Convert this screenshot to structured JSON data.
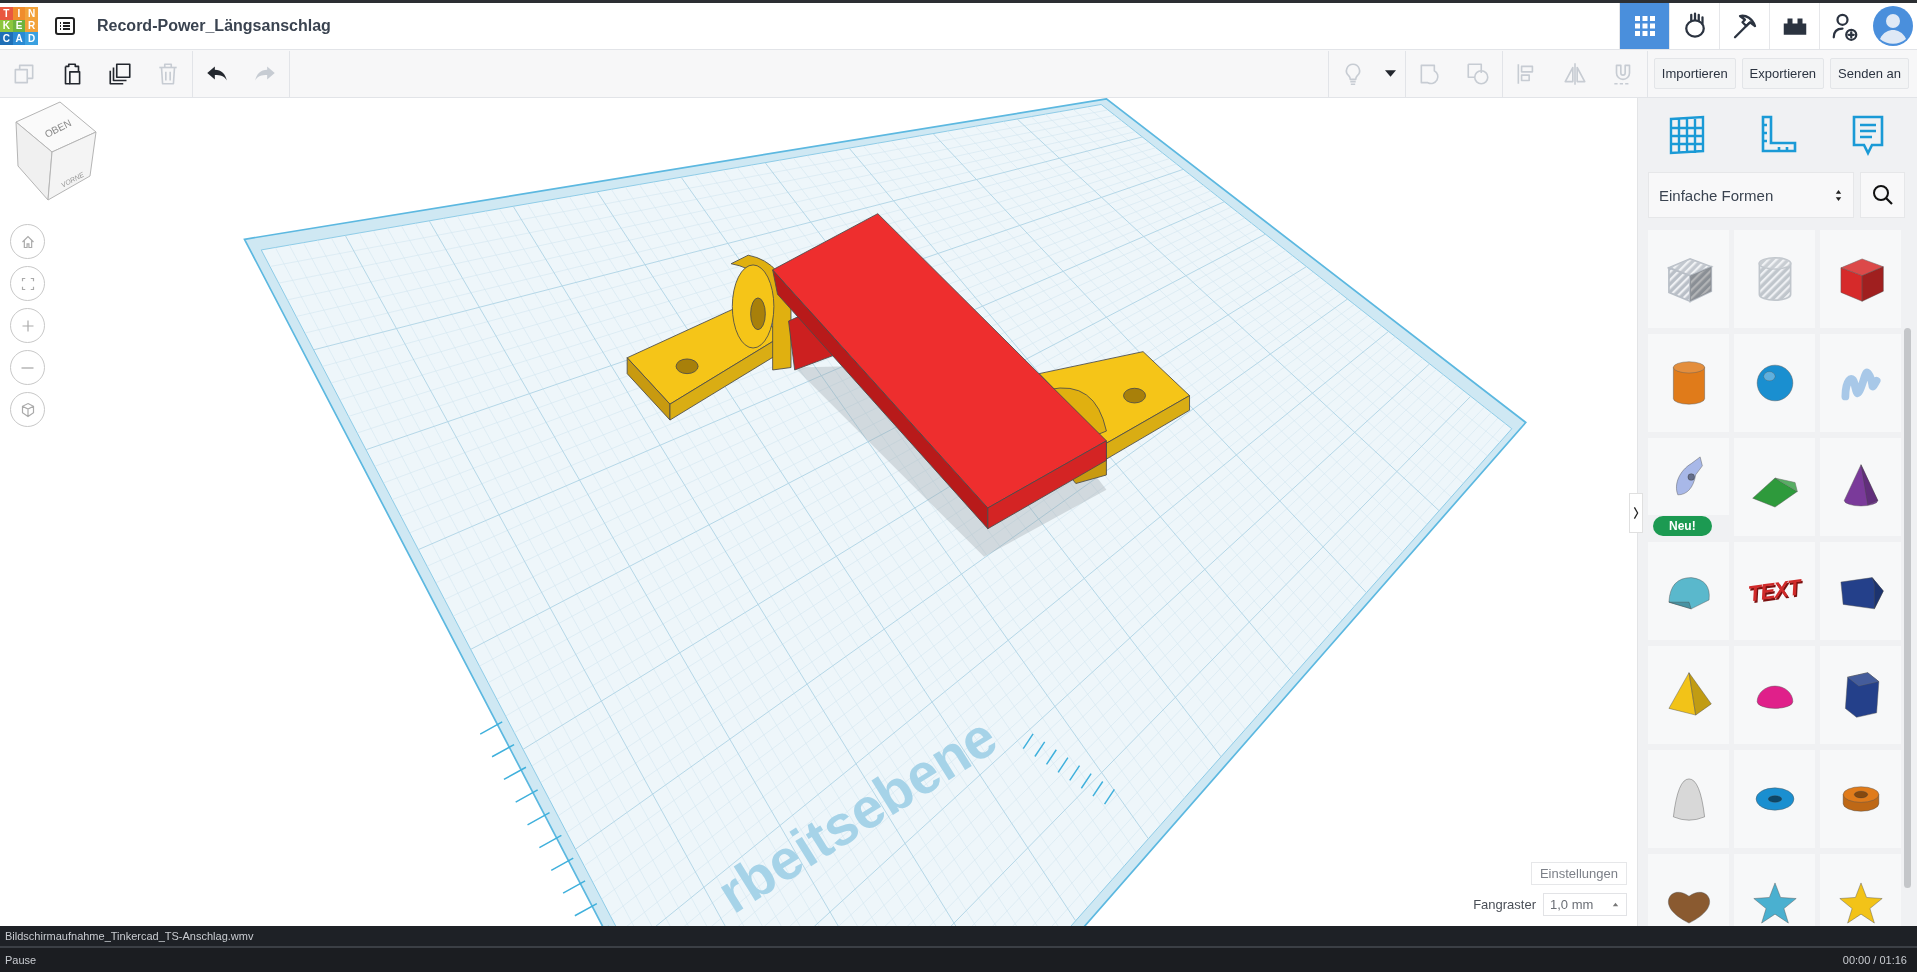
{
  "header": {
    "logo": [
      {
        "letter": "T",
        "color": "#e9573f"
      },
      {
        "letter": "I",
        "color": "#f08c2c"
      },
      {
        "letter": "N",
        "color": "#f2a23a"
      },
      {
        "letter": "K",
        "color": "#8cc63e"
      },
      {
        "letter": "E",
        "color": "#6db33f"
      },
      {
        "letter": "R",
        "color": "#f2a23a"
      },
      {
        "letter": "C",
        "color": "#1e6fb7"
      },
      {
        "letter": "A",
        "color": "#2a8ad4"
      },
      {
        "letter": "D",
        "color": "#3aa0e0"
      }
    ],
    "title": "Record-Power_Längsanschlag",
    "tools": [
      {
        "kind": "grid",
        "selected": true
      },
      {
        "kind": "hand",
        "selected": false
      },
      {
        "kind": "pickaxe",
        "selected": false
      },
      {
        "kind": "brick",
        "selected": false
      },
      {
        "kind": "add-user",
        "selected": false
      }
    ]
  },
  "toolbar": {
    "left": [
      {
        "kind": "copy",
        "disabled": true
      },
      {
        "kind": "paste",
        "disabled": false
      },
      {
        "kind": "duplicate",
        "disabled": false
      },
      {
        "kind": "delete",
        "disabled": true
      },
      {
        "kind": "undo",
        "disabled": false
      },
      {
        "kind": "redo",
        "disabled": true
      }
    ],
    "right": [
      {
        "kind": "light",
        "disabled": true
      },
      {
        "kind": "dropdown",
        "disabled": false
      },
      {
        "kind": "group",
        "disabled": true
      },
      {
        "kind": "ungroup",
        "disabled": true
      },
      {
        "kind": "align",
        "disabled": true
      },
      {
        "kind": "mirror",
        "disabled": true
      },
      {
        "kind": "magnet",
        "disabled": true
      }
    ],
    "buttons": [
      "Importieren",
      "Exportieren",
      "Senden an"
    ]
  },
  "view_cube": {
    "top": "OBEN",
    "front": "VORNE"
  },
  "workplane": {
    "label": "rbeitsebene"
  },
  "canvas_controls": {
    "settings": "Einstellungen",
    "snap_label": "Fangraster",
    "snap_value": "1,0 mm"
  },
  "sidebar": {
    "category": "Einfache Formen",
    "shapes": [
      {
        "kind": "striped-cube",
        "color": "#b9bfc7"
      },
      {
        "kind": "striped-cylinder",
        "color": "#c0c6cc"
      },
      {
        "kind": "cube",
        "color": "#d62a2a"
      },
      {
        "kind": "cylinder",
        "color": "#e07b1a"
      },
      {
        "kind": "sphere",
        "color": "#1a8fd0"
      },
      {
        "kind": "squiggle",
        "color": "#a8c8e8"
      },
      {
        "kind": "pen-tip",
        "color": "#a8b8e8",
        "badge": "Neu!"
      },
      {
        "kind": "wedge",
        "color": "#2e9a3c"
      },
      {
        "kind": "cone",
        "color": "#7a3a9a"
      },
      {
        "kind": "half-cylinder",
        "color": "#5ab8cc"
      },
      {
        "kind": "text",
        "color": "#d02a2a",
        "label": "TEXT"
      },
      {
        "kind": "pentagon-prism",
        "color": "#24408a"
      },
      {
        "kind": "pyramid",
        "color": "#f2c318"
      },
      {
        "kind": "dome",
        "color": "#e0208a"
      },
      {
        "kind": "hexagonal-prism",
        "color": "#24408a"
      },
      {
        "kind": "paraboloid",
        "color": "#d8d8d8"
      },
      {
        "kind": "ring",
        "color": "#1a8fd0"
      },
      {
        "kind": "tube",
        "color": "#e07b1a"
      },
      {
        "kind": "heart",
        "color": "#8a5a30"
      },
      {
        "kind": "star",
        "color": "#4ab0d0"
      },
      {
        "kind": "star",
        "color": "#f2c318"
      }
    ]
  },
  "player": {
    "filename": "Bildschirmaufnahme_Tinkercad_TS-Anschlag.wmv",
    "status": "Pause",
    "time": "00:00 / 01:16"
  }
}
